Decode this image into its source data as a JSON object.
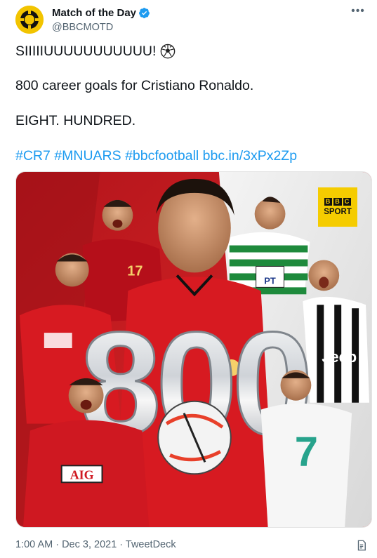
{
  "account": {
    "display_name": "Match of the Day",
    "handle": "@BBCMOTD",
    "verified": true,
    "avatar_color": "#f2c400"
  },
  "menu": {
    "more_label": "•••"
  },
  "tweet": {
    "line1": "SIIIIIUUUUUUUUUUU!",
    "line2": "800 career goals for Cristiano Ronaldo.",
    "line3": "EIGHT. HUNDRED.",
    "hashtags": [
      "#CR7",
      "#MNUARS",
      "#bbcfootball"
    ],
    "link": "bbc.in/3xPx2Zp",
    "emoji_icon": "soccer-ball-icon"
  },
  "media": {
    "big_number": "800",
    "badge_top": [
      "B",
      "B",
      "C"
    ],
    "badge_bottom": "SPORT",
    "shirt_labels": {
      "portugal_number": "17",
      "real_number": "7",
      "mu_sponsor": "AIG",
      "sporting_sponsor": "PT",
      "juve_sponsor": "Jeep"
    }
  },
  "meta": {
    "timestamp": "1:00 AM · Dec 3, 2021 · TweetDeck"
  },
  "colors": {
    "accent": "#1d9bf0",
    "text": "#0f1419",
    "muted": "#536471",
    "bbc_yellow": "#f5cc00",
    "red": "#d71a21"
  }
}
